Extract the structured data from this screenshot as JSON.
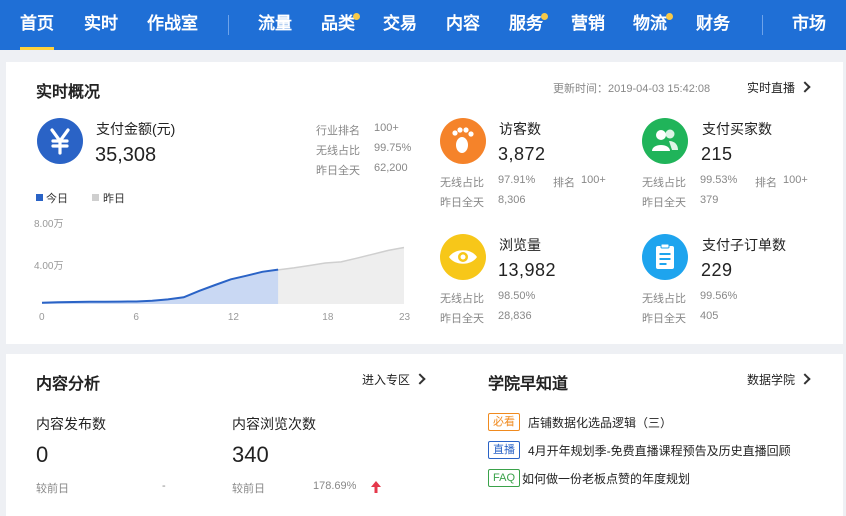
{
  "nav": {
    "items": [
      {
        "label": "首页",
        "active": true,
        "dot": false
      },
      {
        "label": "实时",
        "dot": false
      },
      {
        "label": "作战室",
        "dot": false
      },
      {
        "label": "流量",
        "dot": false
      },
      {
        "label": "品类",
        "dot": true
      },
      {
        "label": "交易",
        "dot": false
      },
      {
        "label": "内容",
        "dot": false
      },
      {
        "label": "服务",
        "dot": true
      },
      {
        "label": "营销",
        "dot": false
      },
      {
        "label": "物流",
        "dot": true
      },
      {
        "label": "财务",
        "dot": false
      },
      {
        "label": "市场",
        "dot": false
      }
    ]
  },
  "realtime": {
    "title": "实时概况",
    "update_label": "更新时间：2019-04-03 15:42:08",
    "live_link": "实时直播",
    "payment": {
      "label": "支付金额(元)",
      "value": "35,308",
      "stats": [
        {
          "k": "行业排名",
          "v": "100+"
        },
        {
          "k": "无线占比",
          "v": "99.75%"
        },
        {
          "k": "昨日全天",
          "v": "62,200"
        }
      ]
    },
    "legend": {
      "today": "今日",
      "yesterday": "昨日"
    },
    "metrics": {
      "visitors": {
        "label": "访客数",
        "value": "3,872",
        "wireless_k": "无线占比",
        "wireless_v": "97.91%",
        "rank_k": "排名",
        "rank_v": "100+",
        "yday_k": "昨日全天",
        "yday_v": "8,306"
      },
      "buyers": {
        "label": "支付买家数",
        "value": "215",
        "wireless_k": "无线占比",
        "wireless_v": "99.53%",
        "rank_k": "排名",
        "rank_v": "100+",
        "yday_k": "昨日全天",
        "yday_v": "379"
      },
      "pageviews": {
        "label": "浏览量",
        "value": "13,982",
        "wireless_k": "无线占比",
        "wireless_v": "98.50%",
        "yday_k": "昨日全天",
        "yday_v": "28,836"
      },
      "suborders": {
        "label": "支付子订单数",
        "value": "229",
        "wireless_k": "无线占比",
        "wireless_v": "99.56%",
        "yday_k": "昨日全天",
        "yday_v": "405"
      }
    }
  },
  "chart_data": {
    "type": "area",
    "x": [
      0,
      1,
      2,
      3,
      4,
      5,
      6,
      7,
      8,
      9,
      10,
      11,
      12,
      13,
      14,
      15,
      16,
      17,
      18,
      19,
      20,
      21,
      22,
      23
    ],
    "xticks": [
      "0",
      "6",
      "12",
      "18",
      "23"
    ],
    "yticks": [
      "8.00万",
      "4.00万"
    ],
    "ylim": [
      0,
      80000
    ],
    "series": [
      {
        "name": "今日",
        "color": "#2a63c6",
        "values": [
          1200,
          1800,
          2100,
          2300,
          2400,
          2500,
          2600,
          3400,
          4700,
          6900,
          13500,
          19500,
          25300,
          29000,
          33000,
          35308
        ]
      },
      {
        "name": "昨日",
        "color": "#cfcfcf",
        "values": [
          1100,
          1600,
          1900,
          2100,
          2200,
          2300,
          2500,
          3300,
          4600,
          6700,
          13000,
          19000,
          24500,
          28500,
          32500,
          35000,
          37000,
          39500,
          42000,
          43200,
          47000,
          51000,
          55000,
          58000
        ]
      }
    ]
  },
  "content": {
    "title": "内容分析",
    "link": "进入专区",
    "publish": {
      "label": "内容发布数",
      "value": "0",
      "cmp_k": "较前日",
      "cmp_v": "-"
    },
    "views": {
      "label": "内容浏览次数",
      "value": "340",
      "cmp_k": "较前日",
      "cmp_v": "178.69%"
    }
  },
  "academy": {
    "title": "学院早知道",
    "link": "数据学院",
    "items": [
      {
        "tag": "必看",
        "tag_color": "#f08a1e",
        "text": "店铺数据化选品逻辑（三）"
      },
      {
        "tag": "直播",
        "tag_color": "#2a63c6",
        "text": "4月开年规划季-免费直播课程预告及历史直播回顾"
      },
      {
        "tag": "FAQ",
        "tag_color": "#3aa24a",
        "text": "如何做一份老板点赞的年度规划"
      }
    ]
  },
  "colors": {
    "nav": "#1f6fd6",
    "today": "#2a63c6",
    "orange": "#f5832a",
    "green": "#20b45a",
    "yellow": "#f7c719",
    "cyan": "#1ea4ee",
    "up": "#e5384b"
  }
}
